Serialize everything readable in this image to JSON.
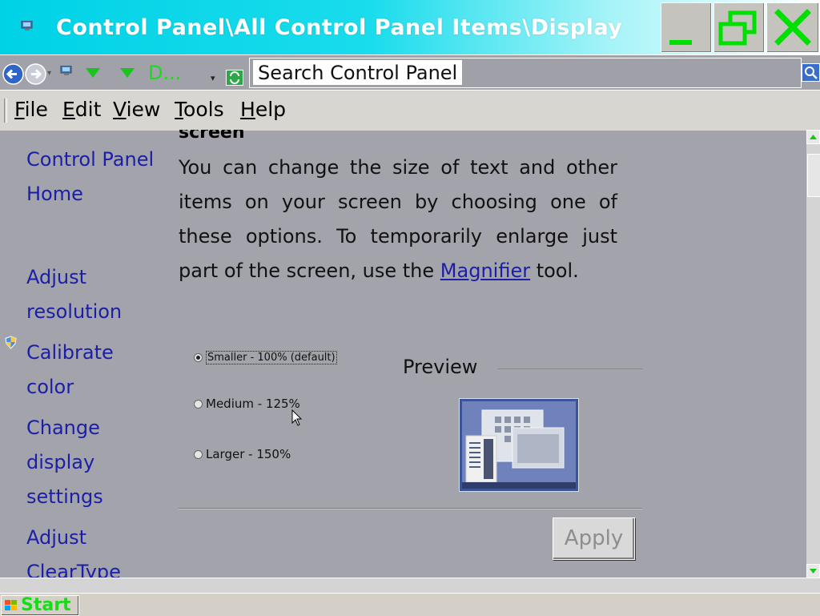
{
  "window": {
    "title": "Control Panel\\All Control Panel Items\\Display",
    "accent_title_color": "#00d2e6",
    "window_button_symbol_color": "#00e000"
  },
  "address_bar": {
    "breadcrumb_text": "D...",
    "search_placeholder": "Search Control Panel"
  },
  "menu": {
    "items": [
      "File",
      "Edit",
      "View",
      "Tools",
      "Help"
    ]
  },
  "sidebar": {
    "links": [
      {
        "label": "Control Panel Home"
      },
      {
        "label": "Adjust resolution"
      },
      {
        "label": "Calibrate color"
      },
      {
        "label": "Change display settings"
      },
      {
        "label": "Adjust ClearType text"
      }
    ]
  },
  "main": {
    "heading": "screen",
    "description_before_link": "You can change the size of text and other items on your screen by choosing one of these options. To temporarily enlarge just part of the screen, use the ",
    "link_text": "Magnifier",
    "description_after_link": " tool.",
    "options": [
      {
        "label": "Smaller - 100% (default)",
        "selected": true
      },
      {
        "label": "Medium - 125%",
        "selected": false
      },
      {
        "label": "Larger - 150%",
        "selected": false
      }
    ],
    "preview_label": "Preview",
    "apply_label": "Apply"
  },
  "taskbar": {
    "start_label": "Start"
  }
}
